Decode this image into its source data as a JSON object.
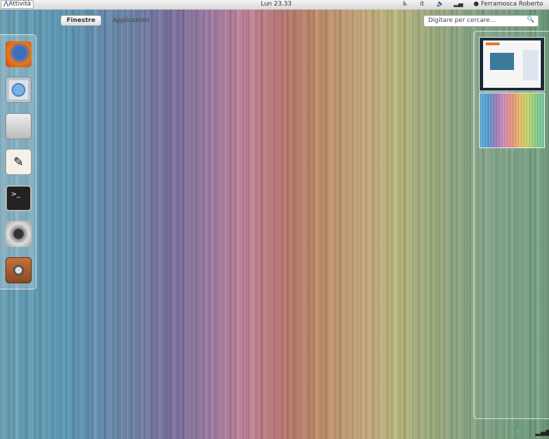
{
  "top_bar": {
    "activities": "Attività",
    "clock": "Lun 23.33",
    "keyboard": "it",
    "user": "Ferramosca Roberto"
  },
  "view_tabs": [
    {
      "label": "Finestre",
      "active": true
    },
    {
      "label": "Applicazioni",
      "active": false
    }
  ],
  "search": {
    "placeholder": "Digitare per cercare..."
  },
  "dash": [
    "firefox-icon",
    "chromium-icon",
    "file-manager-icon",
    "text-editor-icon",
    "terminal-icon",
    "webcam-icon",
    "audio-player-icon"
  ],
  "terminal_prompt": ">_"
}
